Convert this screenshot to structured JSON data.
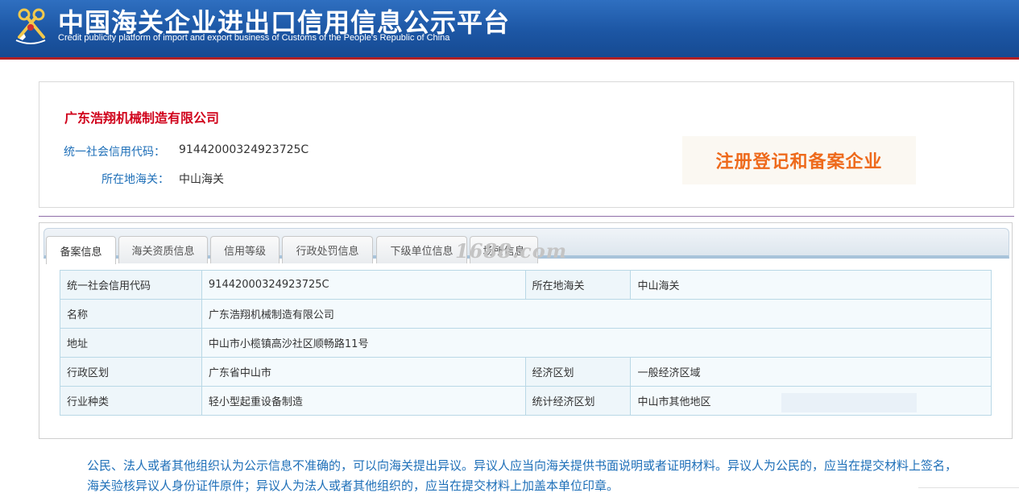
{
  "header": {
    "title": "中国海关企业进出口信用信息公示平台",
    "subtitle": "Credit publicity platform of import and export business of Customs of the People's Republic of China"
  },
  "company": {
    "name": "广东浩翔机械制造有限公司",
    "credit_code_label": "统一社会信用代码：",
    "credit_code": "91442000324923725C",
    "customs_label": "所在地海关：",
    "customs": "中山海关",
    "status_stamp": "注册登记和备案企业"
  },
  "tabs": [
    {
      "label": "备案信息",
      "active": true
    },
    {
      "label": "海关资质信息",
      "active": false
    },
    {
      "label": "信用等级",
      "active": false
    },
    {
      "label": "行政处罚信息",
      "active": false
    },
    {
      "label": "下级单位信息",
      "active": false
    },
    {
      "label": "场所信息",
      "active": false
    }
  ],
  "watermark": "1688.com",
  "info_table": {
    "rows": [
      {
        "l1": "统一社会信用代码",
        "v1": "91442000324923725C",
        "l2": "所在地海关",
        "v2": "中山海关"
      },
      {
        "l1": "名称",
        "v1": "广东浩翔机械制造有限公司"
      },
      {
        "l1": "地址",
        "v1": "中山市小榄镇高沙社区顺畅路11号"
      },
      {
        "l1": "行政区划",
        "v1": "广东省中山市",
        "l2": "经济区划",
        "v2": "一般经济区域"
      },
      {
        "l1": "行业种类",
        "v1": "轻小型起重设备制造",
        "l2": "统计经济区划",
        "v2": "中山市其他地区"
      }
    ]
  },
  "notice": "公民、法人或者其他组织认为公示信息不准确的，可以向海关提出异议。异议人应当向海关提供书面说明或者证明材料。异议人为公民的，应当在提交材料上签名，海关验核异议人身份证件原件；异议人为法人或者其他组织的，应当在提交材料上加盖本单位印章。",
  "colors": {
    "header_blue": "#1c56a4",
    "header_stripe": "#b11f24",
    "company_red": "#d0021b",
    "label_blue": "#1e6fb8",
    "stamp_orange": "#ee6a1c"
  }
}
